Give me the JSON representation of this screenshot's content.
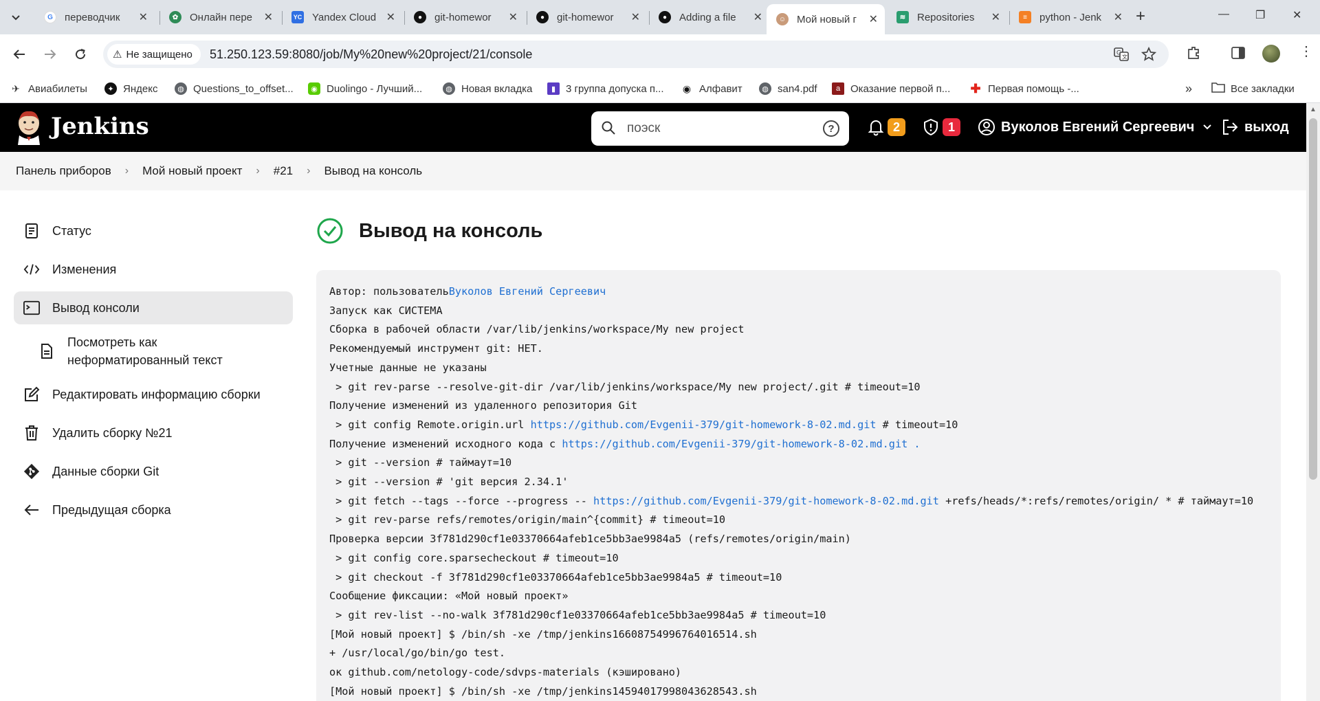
{
  "browser": {
    "tabs": [
      {
        "title": "переводчик",
        "favicon": "google-icon",
        "active": false
      },
      {
        "title": "Онлайн пере",
        "favicon": "translator-icon",
        "active": false
      },
      {
        "title": "Yandex Cloud",
        "favicon": "yandex-cloud-icon",
        "active": false
      },
      {
        "title": "git-homewor",
        "favicon": "github-icon",
        "active": false
      },
      {
        "title": "git-homewor",
        "favicon": "github-icon",
        "active": false
      },
      {
        "title": "Adding a file",
        "favicon": "github-icon",
        "active": false
      },
      {
        "title": "Мой новый г",
        "favicon": "jenkins-icon",
        "active": true
      },
      {
        "title": "Repositories",
        "favicon": "nexus-icon",
        "active": false
      },
      {
        "title": "python - Jenk",
        "favicon": "stackoverflow-icon",
        "active": false
      }
    ],
    "security_label": "Не защищено",
    "url": "51.250.123.59:8080/job/My%20new%20project/21/console",
    "bookmarks": [
      {
        "label": "Авиабилеты",
        "icon": "plane-icon"
      },
      {
        "label": "Яндекс",
        "icon": "yandex-icon"
      },
      {
        "label": "Questions_to_offset...",
        "icon": "globe-icon"
      },
      {
        "label": "Duolingo - Лучший...",
        "icon": "duolingo-icon"
      },
      {
        "label": "Новая вкладка",
        "icon": "globe-icon"
      },
      {
        "label": "3 группа допуска п...",
        "icon": "bookmark-icon"
      },
      {
        "label": "Алфавит",
        "icon": "eye-icon"
      },
      {
        "label": "san4.pdf",
        "icon": "globe-icon"
      },
      {
        "label": "Оказание первой п...",
        "icon": "book-icon"
      },
      {
        "label": "Первая помощь -...",
        "icon": "red-cross-icon"
      }
    ],
    "all_bookmarks_label": "Все закладки"
  },
  "jenkins": {
    "title": "Jenkins",
    "search_placeholder": "поэск",
    "notifications_count": "2",
    "security_count": "1",
    "user_name": "Вуколов Евгений Сергеевич",
    "logout_label": "выход"
  },
  "breadcrumb": [
    "Панель приборов",
    "Мой новый проект",
    "#21",
    "Вывод на консоль"
  ],
  "sidebar": [
    {
      "label": "Статус",
      "icon": "document-icon"
    },
    {
      "label": "Изменения",
      "icon": "code-icon"
    },
    {
      "label": "Вывод консоли",
      "icon": "terminal-icon"
    },
    {
      "label": "Посмотреть как неформатированный текст",
      "icon": "file-icon"
    },
    {
      "label": "Редактировать информацию сборки",
      "icon": "edit-icon"
    },
    {
      "label": "Удалить сборку №21",
      "icon": "trash-icon"
    },
    {
      "label": "Данные сборки Git",
      "icon": "git-icon"
    },
    {
      "label": "Предыдущая сборка",
      "icon": "arrow-left-icon"
    }
  ],
  "page_title": "Вывод на консоль",
  "console": {
    "line1_prefix": "Автор: пользователь",
    "line1_user": "Вуколов Евгений Сергеевич",
    "lines": [
      "Запуск как СИСТЕМА",
      "Сборка в рабочей области /var/lib/jenkins/workspace/My new project",
      "Рекомендуемый инструмент git: НЕТ.",
      "Учетные данные не указаны",
      " > git rev-parse --resolve-git-dir /var/lib/jenkins/workspace/My new project/.git # timeout=10",
      "Получение изменений из удаленного репозитория Git"
    ],
    "config_prefix": " > git config Remote.origin.url ",
    "repo_url": "https://github.com/Evgenii-379/git-homework-8-02.md.git",
    "config_suffix": " # timeout=10",
    "fetch_src_prefix": "Получение изменений исходного кода с ",
    "fetch_src_suffix": " .",
    "lines2": [
      " > git --version # таймаут=10",
      " > git --version # 'git версия 2.34.1'"
    ],
    "fetch_prefix": " > git fetch --tags --force --progress -- ",
    "fetch_suffix": " +refs/heads/*:refs/remotes/origin/ * # таймаут=10",
    "lines3": [
      " > git rev-parse refs/remotes/origin/main^{commit} # timeout=10",
      "Проверка версии 3f781d290cf1e03370664afeb1ce5bb3ae9984a5 (refs/remotes/origin/main)",
      " > git config core.sparsecheckout # timeout=10",
      " > git checkout -f 3f781d290cf1e03370664afeb1ce5bb3ae9984a5 # timeout=10",
      "Сообщение фиксации: «Мой новый проект»",
      " > git rev-list --no-walk 3f781d290cf1e03370664afeb1ce5bb3ae9984a5 # timeout=10",
      "[Мой новый проект] $ /bin/sh -xe /tmp/jenkins16608754996764016514.sh",
      "+ /usr/local/go/bin/go test.",
      "ок github.com/netology-code/sdvps-materials (кэшировано)",
      "[Мой новый проект] $ /bin/sh -xe /tmp/jenkins14594017998043628543.sh"
    ]
  },
  "colors": {
    "success_green": "#1ea64b",
    "link_blue": "#1f6fd1",
    "badge_orange": "#f29d1c",
    "badge_red": "#e8293d"
  }
}
